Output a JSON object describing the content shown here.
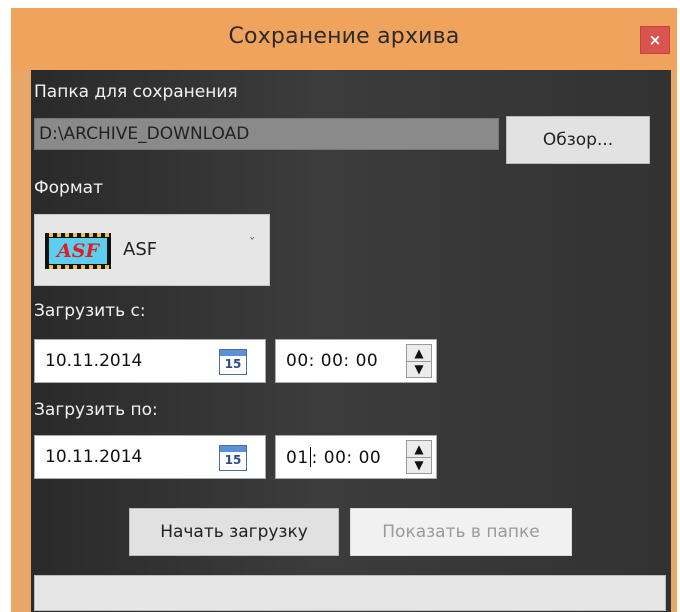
{
  "window": {
    "title": "Сохранение архива",
    "close_label": "×",
    "accent_color": "#f0a35d"
  },
  "save_folder": {
    "label": "Папка для сохранения",
    "path": "D:\\ARCHIVE_DOWNLOAD",
    "browse_label": "Обзор..."
  },
  "format": {
    "label": "Формат",
    "icon_text": "ASF",
    "selected": "ASF",
    "chevron": "ˇ"
  },
  "download_from": {
    "label": "Загрузить с:",
    "date": "10.11.2014",
    "calendar_day": "15",
    "time_hh": "00",
    "time_mm": "00",
    "time_ss": "00"
  },
  "download_to": {
    "label": "Загрузить по:",
    "date": "10.11.2014",
    "calendar_day": "15",
    "time_hh": "01",
    "time_mm": "00",
    "time_ss": "00"
  },
  "actions": {
    "start_label": "Начать загрузку",
    "show_label": "Показать в папке"
  },
  "progress": {
    "value": 0
  },
  "icons": {
    "close": "close-icon",
    "calendar": "calendar-icon",
    "spin_up": "▲",
    "spin_down": "▼",
    "time_sep": ":"
  }
}
